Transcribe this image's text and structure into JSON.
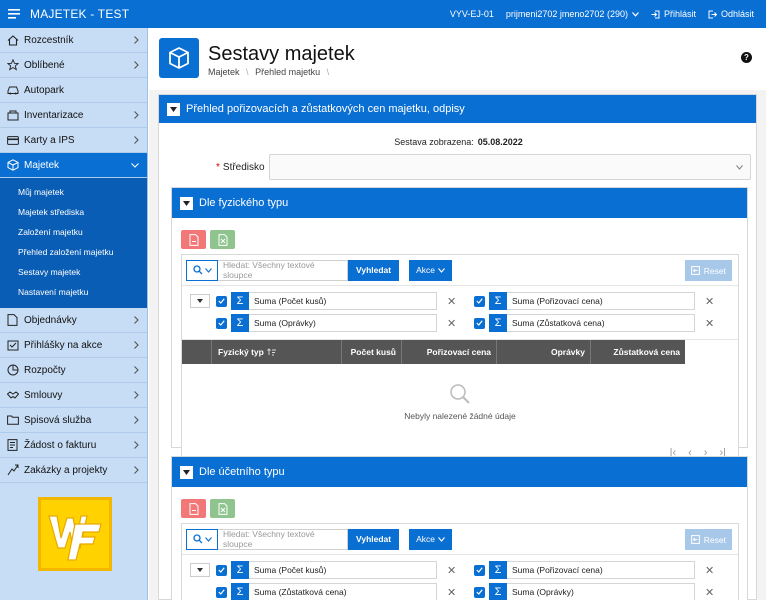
{
  "topbar": {
    "title": "MAJETEK - TEST",
    "env": "VYV-EJ-01",
    "user": "prijmeni2702 jmeno2702 (290)",
    "login_label": "Přihlásit",
    "logout_label": "Odhlásit"
  },
  "sidebar": {
    "items": [
      {
        "label": "Rozcestník",
        "icon": "home-icon"
      },
      {
        "label": "Oblíbené",
        "icon": "star-icon"
      },
      {
        "label": "Autopark",
        "icon": "car-icon"
      },
      {
        "label": "Inventarizace",
        "icon": "inventory-icon"
      },
      {
        "label": "Karty a IPS",
        "icon": "card-icon"
      },
      {
        "label": "Majetek",
        "icon": "cube-icon"
      }
    ],
    "submenu": [
      "Můj majetek",
      "Majetek střediska",
      "Založení majetku",
      "Přehled založení majetku",
      "Sestavy majetek",
      "Nastavení majetku"
    ],
    "items_after": [
      {
        "label": "Objednávky",
        "icon": "document-icon"
      },
      {
        "label": "Přihlášky na akce",
        "icon": "signup-icon"
      },
      {
        "label": "Rozpočty",
        "icon": "budget-icon"
      },
      {
        "label": "Smlouvy",
        "icon": "handshake-icon"
      },
      {
        "label": "Spisová služba",
        "icon": "folder-icon"
      },
      {
        "label": "Žádost o fakturu",
        "icon": "invoice-icon"
      },
      {
        "label": "Zakázky a projekty",
        "icon": "project-icon"
      }
    ]
  },
  "page": {
    "title": "Sestavy majetek",
    "breadcrumb": [
      "Majetek",
      "Přehled majetku"
    ]
  },
  "region": {
    "title": "Přehled pořizovacích a zůstatkových cen majetku, odpisy",
    "sestava_label": "Sestava zobrazena:",
    "sestava_date": "05.08.2022",
    "stredisko_label": "Středisko",
    "stredisko_value": ""
  },
  "ir": {
    "search_placeholder": "Hledat: Všechny textové sloupce",
    "search_button": "Vyhledat",
    "actions_button": "Akce",
    "reset_button": "Reset",
    "nodata": "Nebyly nalezené žádné údaje"
  },
  "physical": {
    "title": "Dle fyzického typu",
    "controls": [
      "Suma (Počet kusů)",
      "Suma (Pořizovací cena)",
      "Suma (Oprávky)",
      "Suma (Zůstatková cena)"
    ],
    "columns": [
      "Fyzický typ",
      "Počet kusů",
      "Pořizovací cena",
      "Oprávky",
      "Zůstatková cena"
    ]
  },
  "accounting": {
    "title": "Dle účetního typu",
    "controls": [
      "Suma (Počet kusů)",
      "Suma (Pořizovací cena)",
      "Suma (Zůstatková cena)",
      "Suma (Oprávky)"
    ]
  },
  "colors": {
    "brand": "#0a6fd3",
    "sidebar_bg": "#c7ddf5",
    "header_dark": "#555555"
  }
}
